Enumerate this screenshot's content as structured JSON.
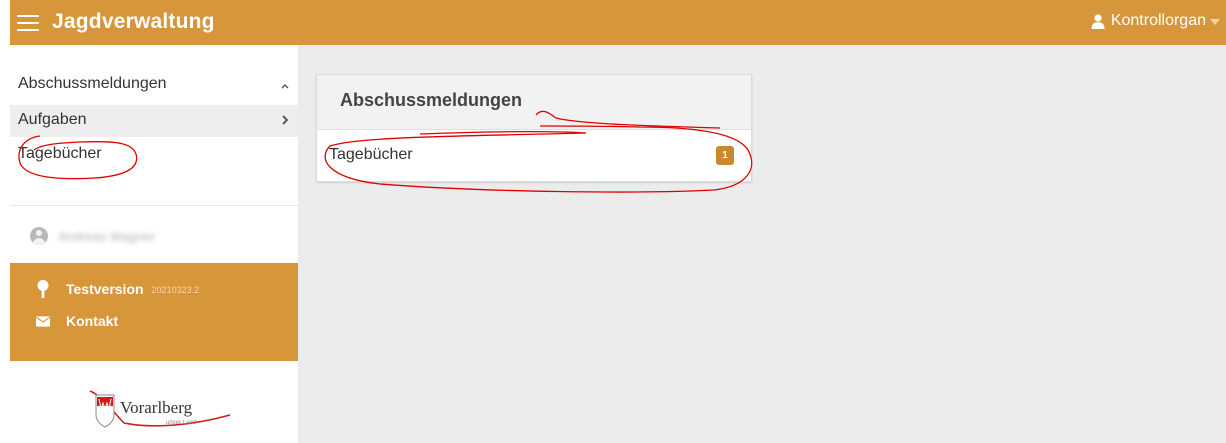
{
  "header": {
    "app_title": "Jagdverwaltung",
    "user_role": "Kontrollorgan",
    "bar_color": "#d8963a"
  },
  "sidebar": {
    "group_label": "Abschussmeldungen",
    "items": [
      {
        "label": "Aufgaben",
        "icon": "chevron-right-icon"
      },
      {
        "label": "Tagebücher"
      }
    ],
    "user_name": "Andreas Wagner",
    "info": {
      "version_label": "Testversion",
      "build": "20210323.2",
      "contact_label": "Kontakt"
    },
    "logo_text": "Vorarlberg",
    "logo_subtext": "unser Land"
  },
  "main": {
    "card": {
      "title": "Abschussmeldungen",
      "rows": [
        {
          "label": "Tagebücher",
          "badge": "1"
        }
      ]
    }
  },
  "annotation_color": "#e00000"
}
